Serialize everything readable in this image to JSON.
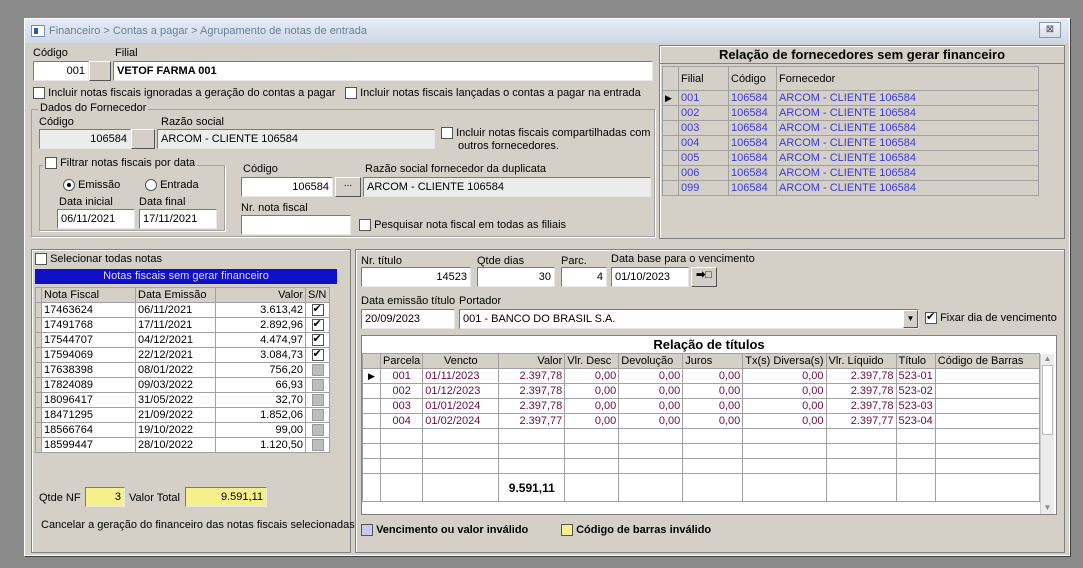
{
  "window": {
    "title": "Financeiro > Contas a pagar > Agrupamento de notas de entrada",
    "close": "⊠"
  },
  "top": {
    "codigo_label": "Código",
    "filial_label": "Filial",
    "codigo_value": "001",
    "filial_value": "VETOF FARMA 001",
    "opt_ignoradas": "Incluir notas fiscais ignoradas a geração do contas a pagar",
    "opt_lancadas": "Incluir notas fiscais lançadas o contas a pagar na entrada"
  },
  "fornecedor": {
    "group_title": "Dados do Fornecedor",
    "codigo_label": "Código",
    "razao_label": "Razão social",
    "codigo_value": "106584",
    "razao_value": "ARCOM - CLIENTE 106584",
    "compartilhadas_l1": "Incluir notas fiscais compartilhadas com",
    "compartilhadas_l2": "outros fornecedores.",
    "filtrar_label": "Filtrar notas fiscais por data",
    "emissao_label": "Emissão",
    "entrada_label": "Entrada",
    "data_inicial_label": "Data inicial",
    "data_final_label": "Data final",
    "data_inicial": "06/11/2021",
    "data_final": "17/11/2021",
    "dup_codigo_label": "Código",
    "dup_razao_label": "Razão social fornecedor da duplicata",
    "dup_codigo": "106584",
    "dup_razao": "ARCOM - CLIENTE 106584",
    "nr_nota_label": "Nr. nota fiscal",
    "pesquisar_label": "Pesquisar nota fiscal em todas as filiais"
  },
  "relacao_fornecedores": {
    "title": "Relação de fornecedores sem gerar financeiro",
    "headers": [
      "Filial",
      "Código",
      "Fornecedor"
    ],
    "rows": [
      [
        "001",
        "106584",
        "ARCOM - CLIENTE 106584"
      ],
      [
        "002",
        "106584",
        "ARCOM - CLIENTE 106584"
      ],
      [
        "003",
        "106584",
        "ARCOM - CLIENTE 106584"
      ],
      [
        "004",
        "106584",
        "ARCOM - CLIENTE 106584"
      ],
      [
        "005",
        "106584",
        "ARCOM - CLIENTE 106584"
      ],
      [
        "006",
        "106584",
        "ARCOM - CLIENTE 106584"
      ],
      [
        "099",
        "106584",
        "ARCOM - CLIENTE 106584"
      ]
    ]
  },
  "notas": {
    "selecionar_todas": "Selecionar todas notas",
    "title": "Notas fiscais sem gerar financeiro",
    "headers": [
      "Nota Fiscal",
      "Data Emissão",
      "Valor",
      "S/N"
    ],
    "rows": [
      {
        "nf": "17463624",
        "data": "06/11/2021",
        "valor": "3.613,42",
        "sn": true
      },
      {
        "nf": "17491768",
        "data": "17/11/2021",
        "valor": "2.892,96",
        "sn": true
      },
      {
        "nf": "17544707",
        "data": "04/12/2021",
        "valor": "4.474,97",
        "sn": true
      },
      {
        "nf": "17594069",
        "data": "22/12/2021",
        "valor": "3.084,73",
        "sn": true
      },
      {
        "nf": "17638398",
        "data": "08/01/2022",
        "valor": "756,20",
        "sn": false
      },
      {
        "nf": "17824089",
        "data": "09/03/2022",
        "valor": "66,93",
        "sn": false
      },
      {
        "nf": "18096417",
        "data": "31/05/2022",
        "valor": "32,70",
        "sn": false
      },
      {
        "nf": "18471295",
        "data": "21/09/2022",
        "valor": "1.852,06",
        "sn": false
      },
      {
        "nf": "18566764",
        "data": "19/10/2022",
        "valor": "99,00",
        "sn": false
      },
      {
        "nf": "18599447",
        "data": "28/10/2022",
        "valor": "1.120,50",
        "sn": false
      }
    ],
    "qtde_nf_label": "Qtde NF",
    "qtde_nf": "3",
    "valor_total_label": "Valor Total",
    "valor_total": "9.591,11",
    "cancelar_label": "Cancelar a geração do financeiro das notas fiscais selecionadas"
  },
  "titulo": {
    "nr_titulo_label": "Nr. título",
    "nr_titulo": "14523",
    "qtde_dias_label": "Qtde dias",
    "qtde_dias": "30",
    "parc_label": "Parc.",
    "parc": "4",
    "data_base_label": "Data base para o vencimento",
    "data_base": "01/10/2023",
    "data_emissao_label": "Data emissão título",
    "data_emissao": "20/09/2023",
    "portador_label": "Portador",
    "portador": "001 - BANCO DO BRASIL S.A.",
    "fixar_label": "Fixar dia de vencimento"
  },
  "relacao_titulos": {
    "title": "Relação de títulos",
    "headers": [
      "Parcela",
      "Vencto",
      "Valor",
      "Vlr. Desc",
      "Devolução",
      "Juros",
      "Tx(s) Diversa(s)",
      "Vlr. Líquido",
      "Título",
      "Código de Barras"
    ],
    "rows": [
      [
        "001",
        "01/11/2023",
        "2.397,78",
        "0,00",
        "0,00",
        "0,00",
        "0,00",
        "2.397,78",
        "523-01",
        ""
      ],
      [
        "002",
        "01/12/2023",
        "2.397,78",
        "0,00",
        "0,00",
        "0,00",
        "0,00",
        "2.397,78",
        "523-02",
        ""
      ],
      [
        "003",
        "01/01/2024",
        "2.397,78",
        "0,00",
        "0,00",
        "0,00",
        "0,00",
        "2.397,78",
        "523-03",
        ""
      ],
      [
        "004",
        "01/02/2024",
        "2.397,77",
        "0,00",
        "0,00",
        "0,00",
        "0,00",
        "2.397,77",
        "523-04",
        ""
      ]
    ],
    "total": "9.591,11"
  },
  "legend": {
    "invalid_due": "Vencimento ou valor inválido",
    "invalid_due_color": "#c8c8f0",
    "invalid_barcode": "Código de barras inválido",
    "invalid_barcode_color": "#f5f08c"
  }
}
